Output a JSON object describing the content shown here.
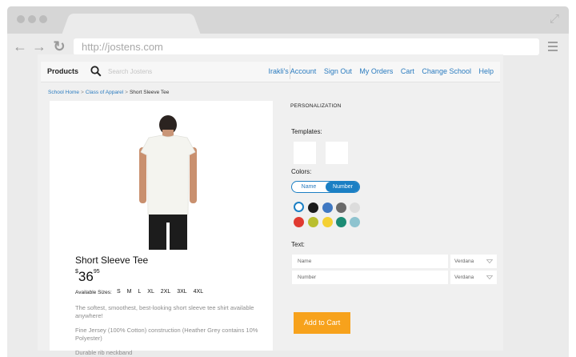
{
  "browser": {
    "url": "http://jostens.com"
  },
  "nav": {
    "products_label": "Products",
    "search_placeholder": "Search Jostens",
    "links": [
      "Irakli's Account",
      "Sign Out",
      "My Orders",
      "Cart",
      "Change School",
      "Help"
    ]
  },
  "breadcrumb": {
    "items": [
      "School Home",
      "Class of Apparel"
    ],
    "current": "Short Sleeve Tee"
  },
  "product": {
    "title": "Short Sleeve Tee",
    "price_currency": "$",
    "price_main": "36",
    "price_cents": "95",
    "sizes_label": "Available Sizes:",
    "sizes": [
      "S",
      "M",
      "L",
      "XL",
      "2XL",
      "3XL",
      "4XL"
    ],
    "description": [
      "The softest, smoothest, best-looking short sleeve tee shirt available anywhere!",
      "Fine Jersey (100% Cotton) construction (Heather Grey contains 10% Polyester)",
      "Durable rib neckband"
    ]
  },
  "personalization": {
    "heading": "PERSONALIZATION",
    "templates_label": "Templates:",
    "colors_label": "Colors:",
    "toggle": {
      "name": "Name",
      "number": "Number",
      "selected": "Number"
    },
    "swatches": [
      "#ffffff",
      "#1a1a1a",
      "#3f78c2",
      "#6a6a6a",
      "#dcdcdc",
      "#e03a31",
      "#b9bf2f",
      "#f4d033",
      "#1c8b74",
      "#8ec3cf"
    ],
    "text_label": "Text:",
    "fields": [
      {
        "placeholder": "Name",
        "font": "Verdana"
      },
      {
        "placeholder": "Number",
        "font": "Verdana"
      }
    ],
    "add_to_cart": "Add to Cart"
  }
}
